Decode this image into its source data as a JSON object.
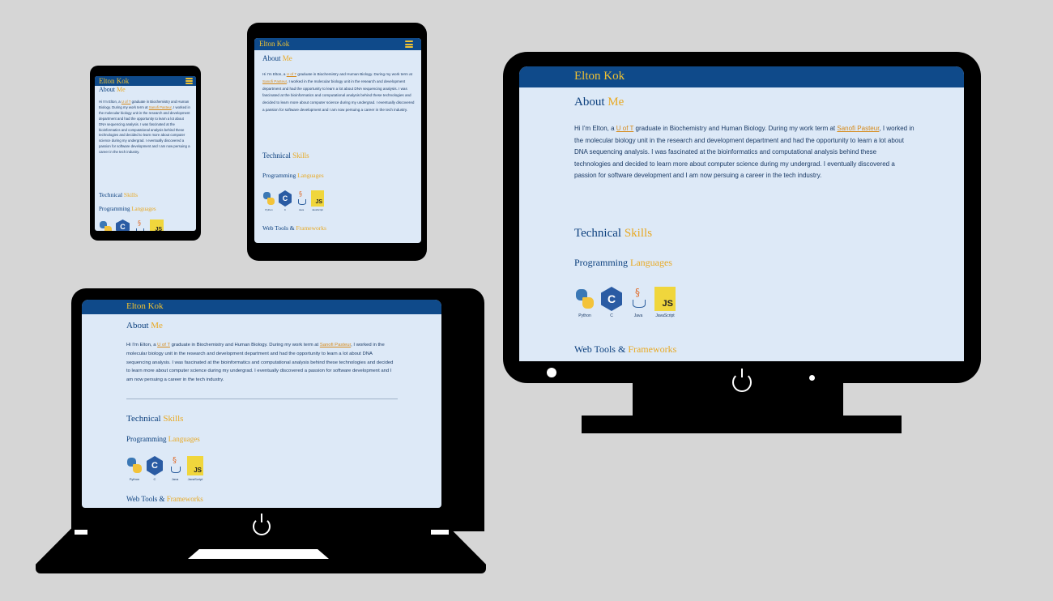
{
  "site": {
    "brand": "Elton Kok",
    "about_word1": "About",
    "about_word2": "Me",
    "para_intro": "Hi I'm Elton, a",
    "para_link1": "U of T",
    "para_mid": "graduate in Biochemistry and Human Biology. During my work term at",
    "para_link2": "Sanofi Pasteur",
    "para_rest": ", I worked in the molecular biology unit in the research and development department and had the opportunity to learn a lot about DNA sequencing analysis. I was fascinated at the bioinformatics and computational analysis behind these technologies and decided to learn more about computer science during my undergrad. I eventually discovered a passion for software development and I am now persuing a career in the tech industry.",
    "tech_word1": "Technical",
    "tech_word2": "Skills",
    "prog_word1": "Programming",
    "prog_word2": "Languages",
    "web_word1": "Web Tools &",
    "web_word2": "Frameworks",
    "languages": [
      {
        "name": "Python",
        "icon": "python-icon"
      },
      {
        "name": "C",
        "icon": "c-language-icon"
      },
      {
        "name": "Java",
        "icon": "java-icon"
      },
      {
        "name": "JavaScript",
        "icon": "javascript-icon"
      }
    ],
    "colors": {
      "header": "#0f4a8a",
      "accent": "#f1c232",
      "background": "#dde9f7",
      "navy_text": "#0b3f7d"
    }
  }
}
